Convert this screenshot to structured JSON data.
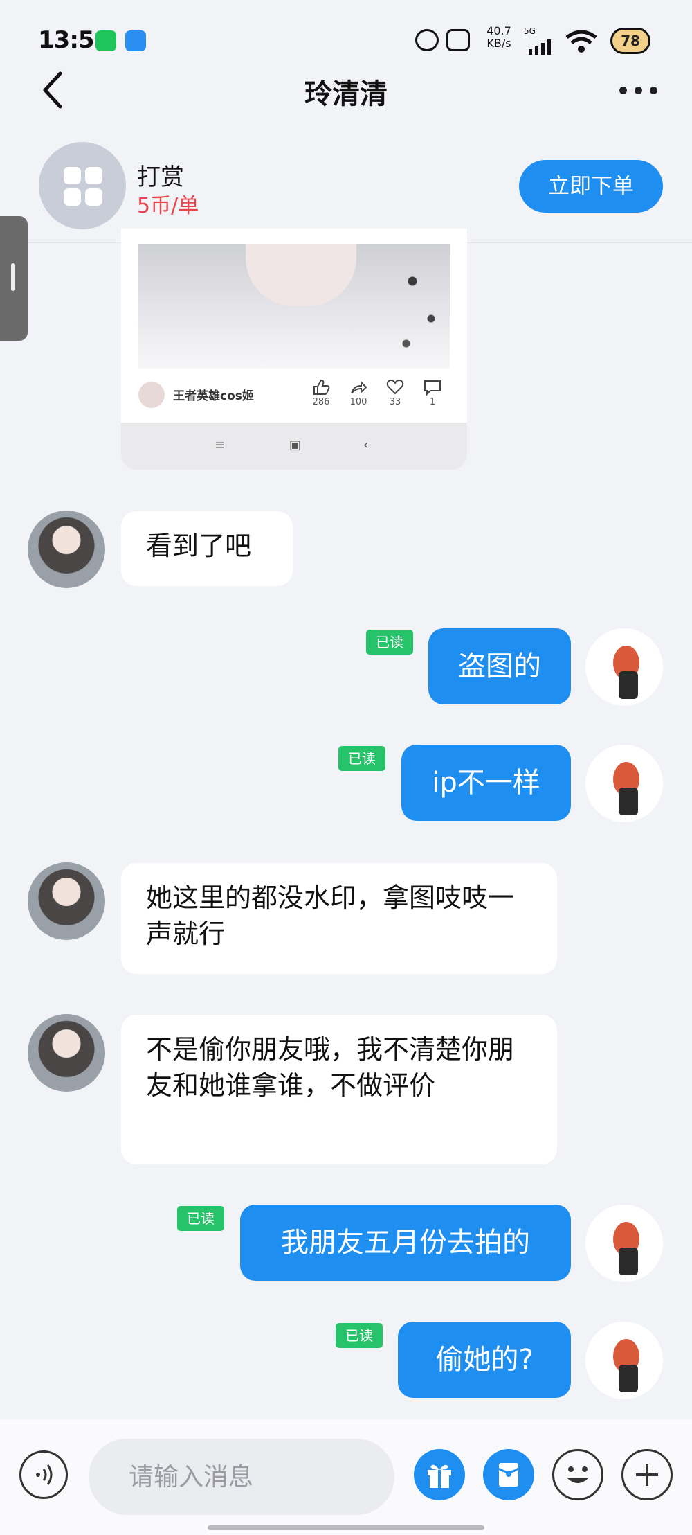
{
  "status_bar": {
    "time": "13:56",
    "net_speed_value": "40.7",
    "net_speed_unit": "KB/s",
    "network": "5G",
    "battery": "78"
  },
  "header": {
    "title": "玲清清"
  },
  "reward": {
    "title": "打赏",
    "price": "5币/单",
    "order_button": "立即下单"
  },
  "shared_post": {
    "user": "王者英雄cos姬",
    "likes": "286",
    "shares": "100",
    "favorites": "33",
    "comments": "1"
  },
  "messages": [
    {
      "side": "left",
      "text": "看到了吧"
    },
    {
      "side": "right",
      "text": "盗图的",
      "status": "已读"
    },
    {
      "side": "right",
      "text": "ip不一样",
      "status": "已读"
    },
    {
      "side": "left",
      "text": "她这里的都没水印，拿图吱吱一声就行"
    },
    {
      "side": "left",
      "text": "不是偷你朋友哦，我不清楚你朋友和她谁拿谁，不做评价"
    },
    {
      "side": "right",
      "text": "我朋友五月份去拍的",
      "status": "已读"
    },
    {
      "side": "right",
      "text": "偷她的?",
      "status": "已读"
    }
  ],
  "input": {
    "placeholder": "请输入消息"
  },
  "colors": {
    "accent": "#1e8ef0",
    "read_badge": "#27c36a",
    "price": "#e8444c",
    "background": "#f2f3f7"
  },
  "icons": [
    "back-icon",
    "more-icon",
    "voice-icon",
    "gift-icon",
    "red-packet-icon",
    "emoji-icon",
    "plus-icon"
  ]
}
